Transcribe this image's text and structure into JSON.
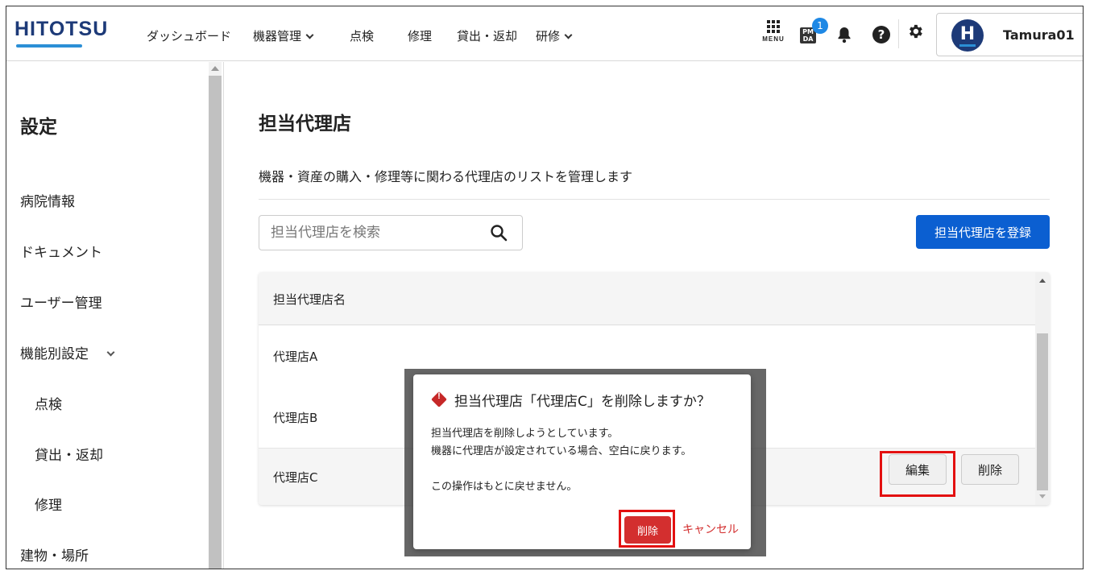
{
  "header": {
    "logo": "HITOTSU",
    "nav": {
      "dashboard": "ダッシュボード",
      "equipment": "機器管理",
      "inspection": "点検",
      "repair": "修理",
      "lending": "貸出・返却",
      "training": "研修"
    },
    "menu_label": "MENU",
    "pmda_label": "PM DA",
    "notification_count": "1",
    "help_label": "?",
    "user": {
      "avatar_letter": "H",
      "name": "Tamura01"
    }
  },
  "sidebar": {
    "title": "設定",
    "items": {
      "hospital": "病院情報",
      "documents": "ドキュメント",
      "users": "ユーザー管理",
      "features": "機能別設定",
      "inspection": "点検",
      "lending": "貸出・返却",
      "repair": "修理",
      "buildings": "建物・場所"
    }
  },
  "main": {
    "title": "担当代理店",
    "description": "機器・資産の購入・修理等に関わる代理店のリストを管理します",
    "search_placeholder": "担当代理店を検索",
    "register_button": "担当代理店を登録",
    "table": {
      "header": "担当代理店名",
      "rows": [
        "代理店A",
        "代理店B",
        "代理店C"
      ],
      "edit_button": "編集",
      "delete_button": "削除"
    }
  },
  "modal": {
    "title": "担当代理店「代理店C」を削除しますか？",
    "line1": "担当代理店を削除しようとしています。",
    "line2": "機器に代理店が設定されている場合、空白に戻ります。",
    "line3": "この操作はもとに戻せません。",
    "delete_button": "削除",
    "cancel_button": "キャンセル",
    "icon_mark": "!"
  },
  "colors": {
    "primary": "#0b5fd1",
    "danger": "#d32f2f",
    "highlight": "#e31010",
    "brand": "#1d3a78"
  }
}
